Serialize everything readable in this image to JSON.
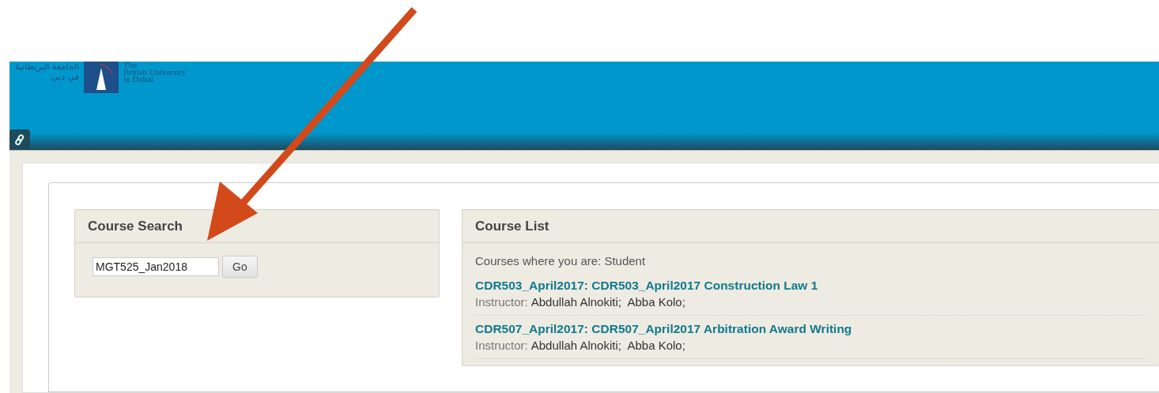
{
  "header": {
    "logo_arabic": "الجامعة البريطانية في دبي",
    "logo_lines": [
      "The",
      "British University",
      "in Dubai"
    ]
  },
  "course_search": {
    "title": "Course Search",
    "value": "MGT525_Jan2018",
    "button": "Go"
  },
  "course_list": {
    "title": "Course List",
    "role_heading": "Courses where you are: Student",
    "courses": [
      {
        "title": "CDR503_April2017: CDR503_April2017 Construction Law 1",
        "instructor_label": "Instructor:",
        "instructors": "Abdullah Alnokiti;  Abba Kolo;"
      },
      {
        "title": "CDR507_April2017: CDR507_April2017 Arbitration Award Writing",
        "instructor_label": "Instructor:",
        "instructors": "Abdullah Alnokiti;  Abba Kolo;"
      }
    ]
  }
}
